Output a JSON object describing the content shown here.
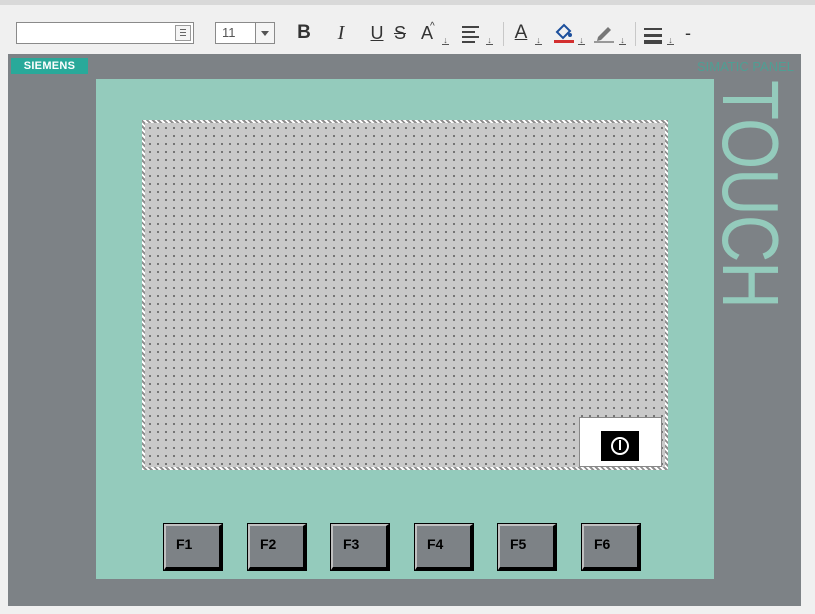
{
  "toolbar": {
    "font_name": "",
    "font_size": "11",
    "bold_label": "B",
    "italic_label": "I",
    "underline_label": "U",
    "strike_label": "S",
    "text_size_label": "A",
    "font_color_label": "A",
    "font_color_accent": "#d32f2f",
    "fill_color_accent": "#d32f2f"
  },
  "panel": {
    "brand": "SIEMENS",
    "model": "SIMATIC PANEL",
    "side_text": "TOUCH",
    "bezel_color": "#94cbbc",
    "frame_color": "#7d8286",
    "function_keys": [
      "F1",
      "F2",
      "F3",
      "F4",
      "F5",
      "F6"
    ]
  }
}
